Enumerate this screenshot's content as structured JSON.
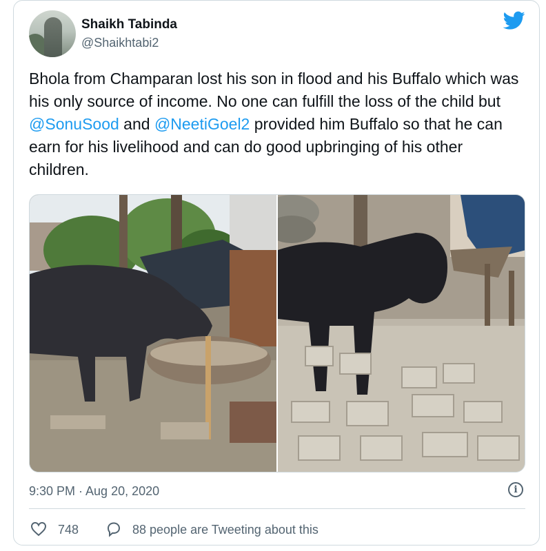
{
  "tweet": {
    "author_name": "Shaikh Tabinda",
    "author_handle": "@Shaikhtabi2",
    "text_segments": [
      "Bhola from Champaran lost his son in flood and his Buffalo which was his only source of income. No one can fulfill the loss of the child but ",
      "@SonuSood",
      " and ",
      "@NeetiGoel2",
      " provided him Buffalo so that he can earn for his livelihood and can do good upbringing of his other children."
    ],
    "timestamp": "9:30 PM · Aug 20, 2020",
    "likes": "748",
    "tweeting_about": "88 people are Tweeting about this",
    "info_glyph": "i"
  },
  "icons": {
    "brand": "twitter-bird-icon",
    "like": "heart-icon",
    "reply": "speech-bubble-icon",
    "info": "info-icon"
  },
  "colors": {
    "link": "#1d9bf0",
    "text": "#0f1419",
    "muted": "#536471",
    "border": "#cfd9de",
    "brand": "#1d9bf0"
  }
}
